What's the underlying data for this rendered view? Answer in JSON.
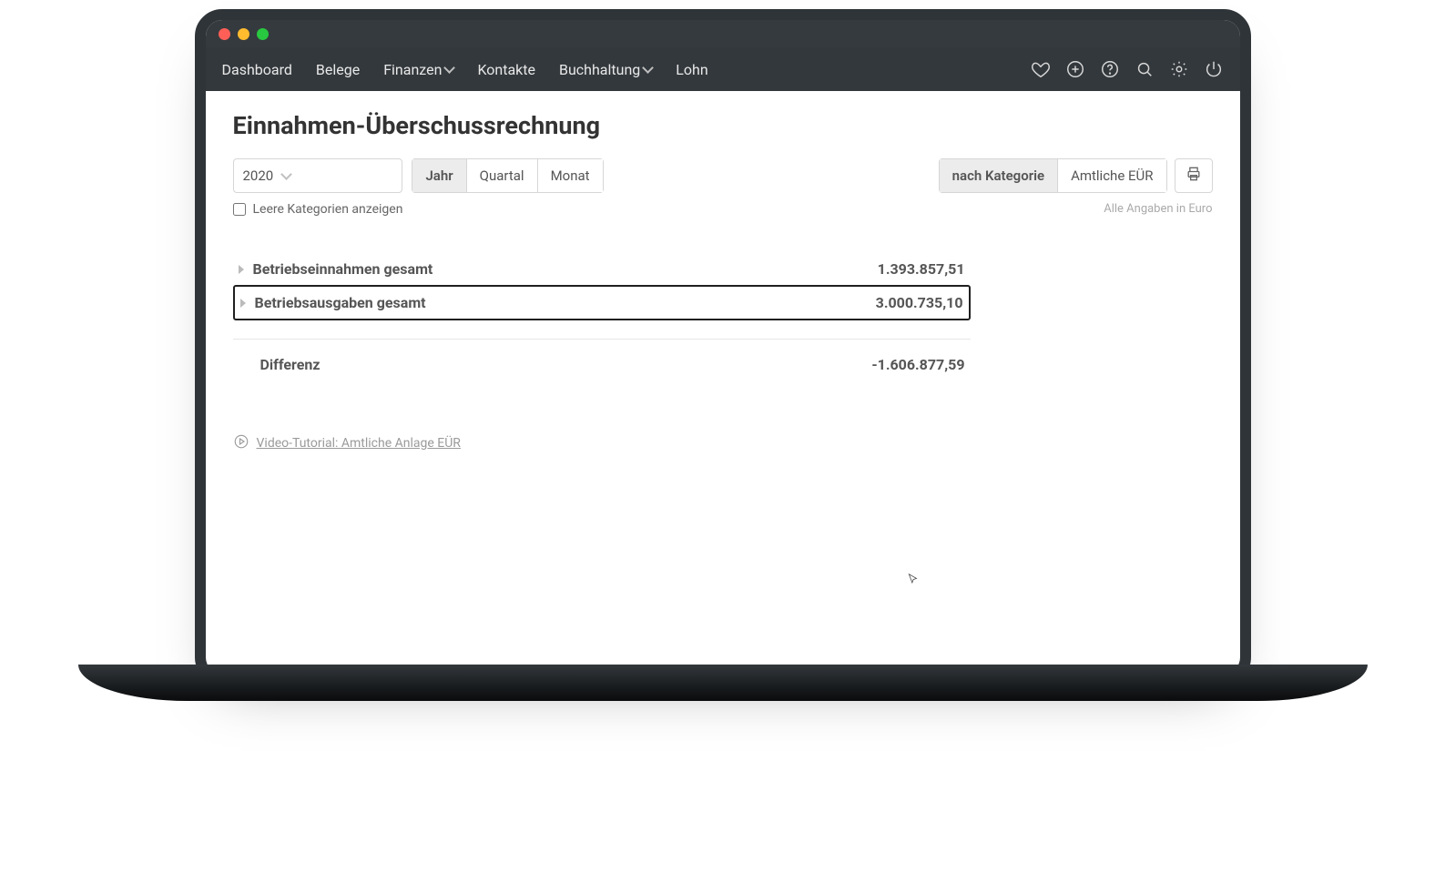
{
  "nav": {
    "items": [
      "Dashboard",
      "Belege",
      "Finanzen",
      "Kontakte",
      "Buchhaltung",
      "Lohn"
    ],
    "dropdowns": [
      false,
      false,
      true,
      false,
      true,
      false
    ]
  },
  "page": {
    "title": "Einnahmen-Überschussrechnung"
  },
  "filters": {
    "year": "2020",
    "period_options": [
      "Jahr",
      "Quartal",
      "Monat"
    ],
    "period_active": 0,
    "empty_categories_label": "Leere Kategorien anzeigen",
    "empty_categories_checked": false
  },
  "view": {
    "options": [
      "nach Kategorie",
      "Amtliche EÜR"
    ],
    "active": 0,
    "currency_hint": "Alle Angaben in Euro"
  },
  "rows": [
    {
      "label": "Betriebseinnahmen gesamt",
      "value": "1.393.857,51",
      "highlight": false
    },
    {
      "label": "Betriebsausgaben gesamt",
      "value": "3.000.735,10",
      "highlight": true
    }
  ],
  "diff": {
    "label": "Differenz",
    "value": "-1.606.877,59"
  },
  "tutorial": {
    "label": " Video-Tutorial: Amtliche Anlage EÜR"
  }
}
